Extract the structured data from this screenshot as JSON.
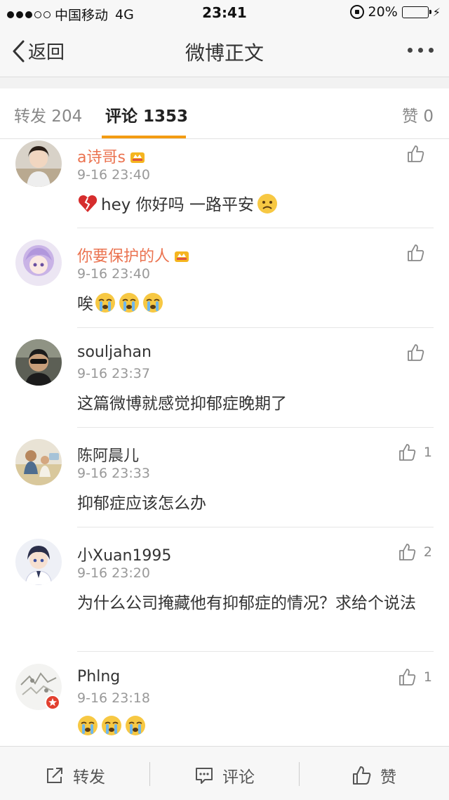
{
  "status_bar": {
    "carrier": "中国移动",
    "network": "4G",
    "time": "23:41",
    "battery": "20%",
    "battery_level": 0.2
  },
  "nav": {
    "back_label": "返回",
    "title": "微博正文"
  },
  "tabs": {
    "repost": "转发 204",
    "comments": "评论 1353",
    "likes": "赞 0"
  },
  "comments": [
    {
      "user": "a诗哥s",
      "time": "9-16 23:40",
      "text": "hey 你好吗 一路平安",
      "likes": ""
    },
    {
      "user": "你要保护的人",
      "time": "9-16 23:40",
      "text": "唉",
      "likes": ""
    },
    {
      "user": "souljahan",
      "time": "9-16 23:37",
      "text": "这篇微博就感觉抑郁症晚期了",
      "likes": ""
    },
    {
      "user": "陈阿晨儿",
      "time": "9-16 23:33",
      "text": "抑郁症应该怎么办",
      "likes": "1"
    },
    {
      "user": "小Xuan1995",
      "time": "9-16 23:20",
      "text": "为什么公司掩藏他有抑郁症的情况？求给个说法",
      "likes": "2"
    },
    {
      "user": "Phlng",
      "time": "9-16 23:18",
      "text": "",
      "likes": "1"
    }
  ],
  "toolbar": {
    "repost": "转发",
    "comment": "评论",
    "like": "赞"
  },
  "colors": {
    "accent": "#f39c12",
    "vip_name": "#eb7350"
  }
}
